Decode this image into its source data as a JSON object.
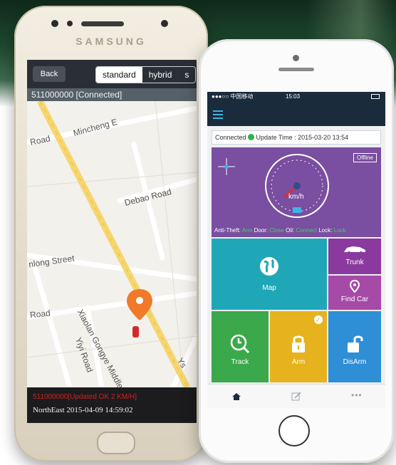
{
  "samsung": {
    "brand": "SAMSUNG",
    "nav": {
      "back_label": "Back",
      "map_types": [
        "standard",
        "hybrid",
        "s"
      ],
      "selected_map_type": "standard"
    },
    "connection_text": "511000000 [Connected]",
    "map_labels": {
      "road_1": "Mincheng E",
      "road_2": "Road",
      "road_3": "Debao Road",
      "road_4": "nlong Street",
      "road_5": "Road",
      "road_6": "Xiaolan Gongye Middle Avenue",
      "road_7": "Yiyi Road",
      "road_8": "Ys"
    },
    "status_red": "511000000[Updated OK 2 KM/H]",
    "status_line": "NorthEast 2015-04-09 14:59:02"
  },
  "iphone": {
    "status_bar": {
      "carrier": "●●●○○ 中国移动",
      "time": "15:03"
    },
    "info": {
      "connected_label": "Connected",
      "update_label": "Update Time : 2015-03-20 13:54"
    },
    "dashboard": {
      "offline_label": "Offline",
      "unit": "km/h",
      "status_line": {
        "anti_theft_label": "Anti-Theft:",
        "anti_theft_value": "Arm",
        "door_label": "Door:",
        "door_value": "Close",
        "oil_label": "Oil:",
        "oil_value": "Connect",
        "lock_label": "Lock:",
        "lock_value": "Lock"
      }
    },
    "tiles": {
      "map": "Map",
      "trunk": "Trunk",
      "find_car": "Find Car",
      "track": "Track",
      "arm": "Arm",
      "disarm": "DisArm"
    },
    "colors": {
      "header": "#1a2b3c",
      "dashboard": "#7a4ea0",
      "map_tile": "#1fa7b8",
      "trunk_tile": "#8a3a9e",
      "findcar_tile": "#a64aa8",
      "track_tile": "#3aa84b",
      "arm_tile": "#e6b31e",
      "disarm_tile": "#2e8fd6"
    },
    "tabbar": [
      "home-icon",
      "edit-icon",
      "more-icon"
    ]
  }
}
